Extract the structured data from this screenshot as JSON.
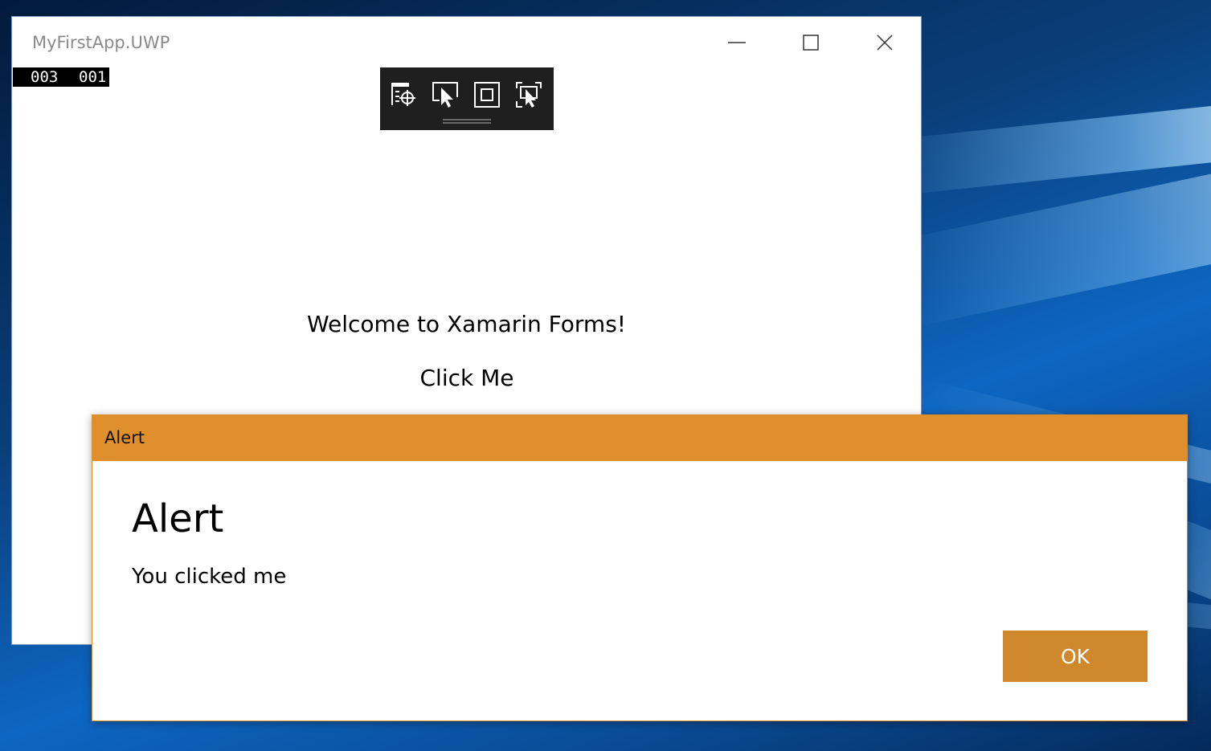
{
  "window": {
    "title": "MyFirstApp.UWP",
    "controls": {
      "minimize_icon": "minimize-icon",
      "maximize_icon": "maximize-icon",
      "close_icon": "close-icon"
    }
  },
  "frame_counter": {
    "left": "003",
    "right": "001"
  },
  "debug_toolbar": {
    "tools": [
      {
        "icon": "live-visual-tree-target-icon"
      },
      {
        "icon": "select-element-icon"
      },
      {
        "icon": "display-layout-adorners-icon"
      },
      {
        "icon": "track-focus-icon"
      }
    ]
  },
  "main": {
    "welcome_text": "Welcome to Xamarin Forms!",
    "click_button_label": "Click Me"
  },
  "dialog": {
    "titlebar_text": "Alert",
    "title": "Alert",
    "message": "You clicked me",
    "ok_label": "OK"
  },
  "colors": {
    "dialog_accent": "#df8f2c",
    "ok_button": "#cf892c",
    "toolbar_bg": "#1f1f1f"
  }
}
